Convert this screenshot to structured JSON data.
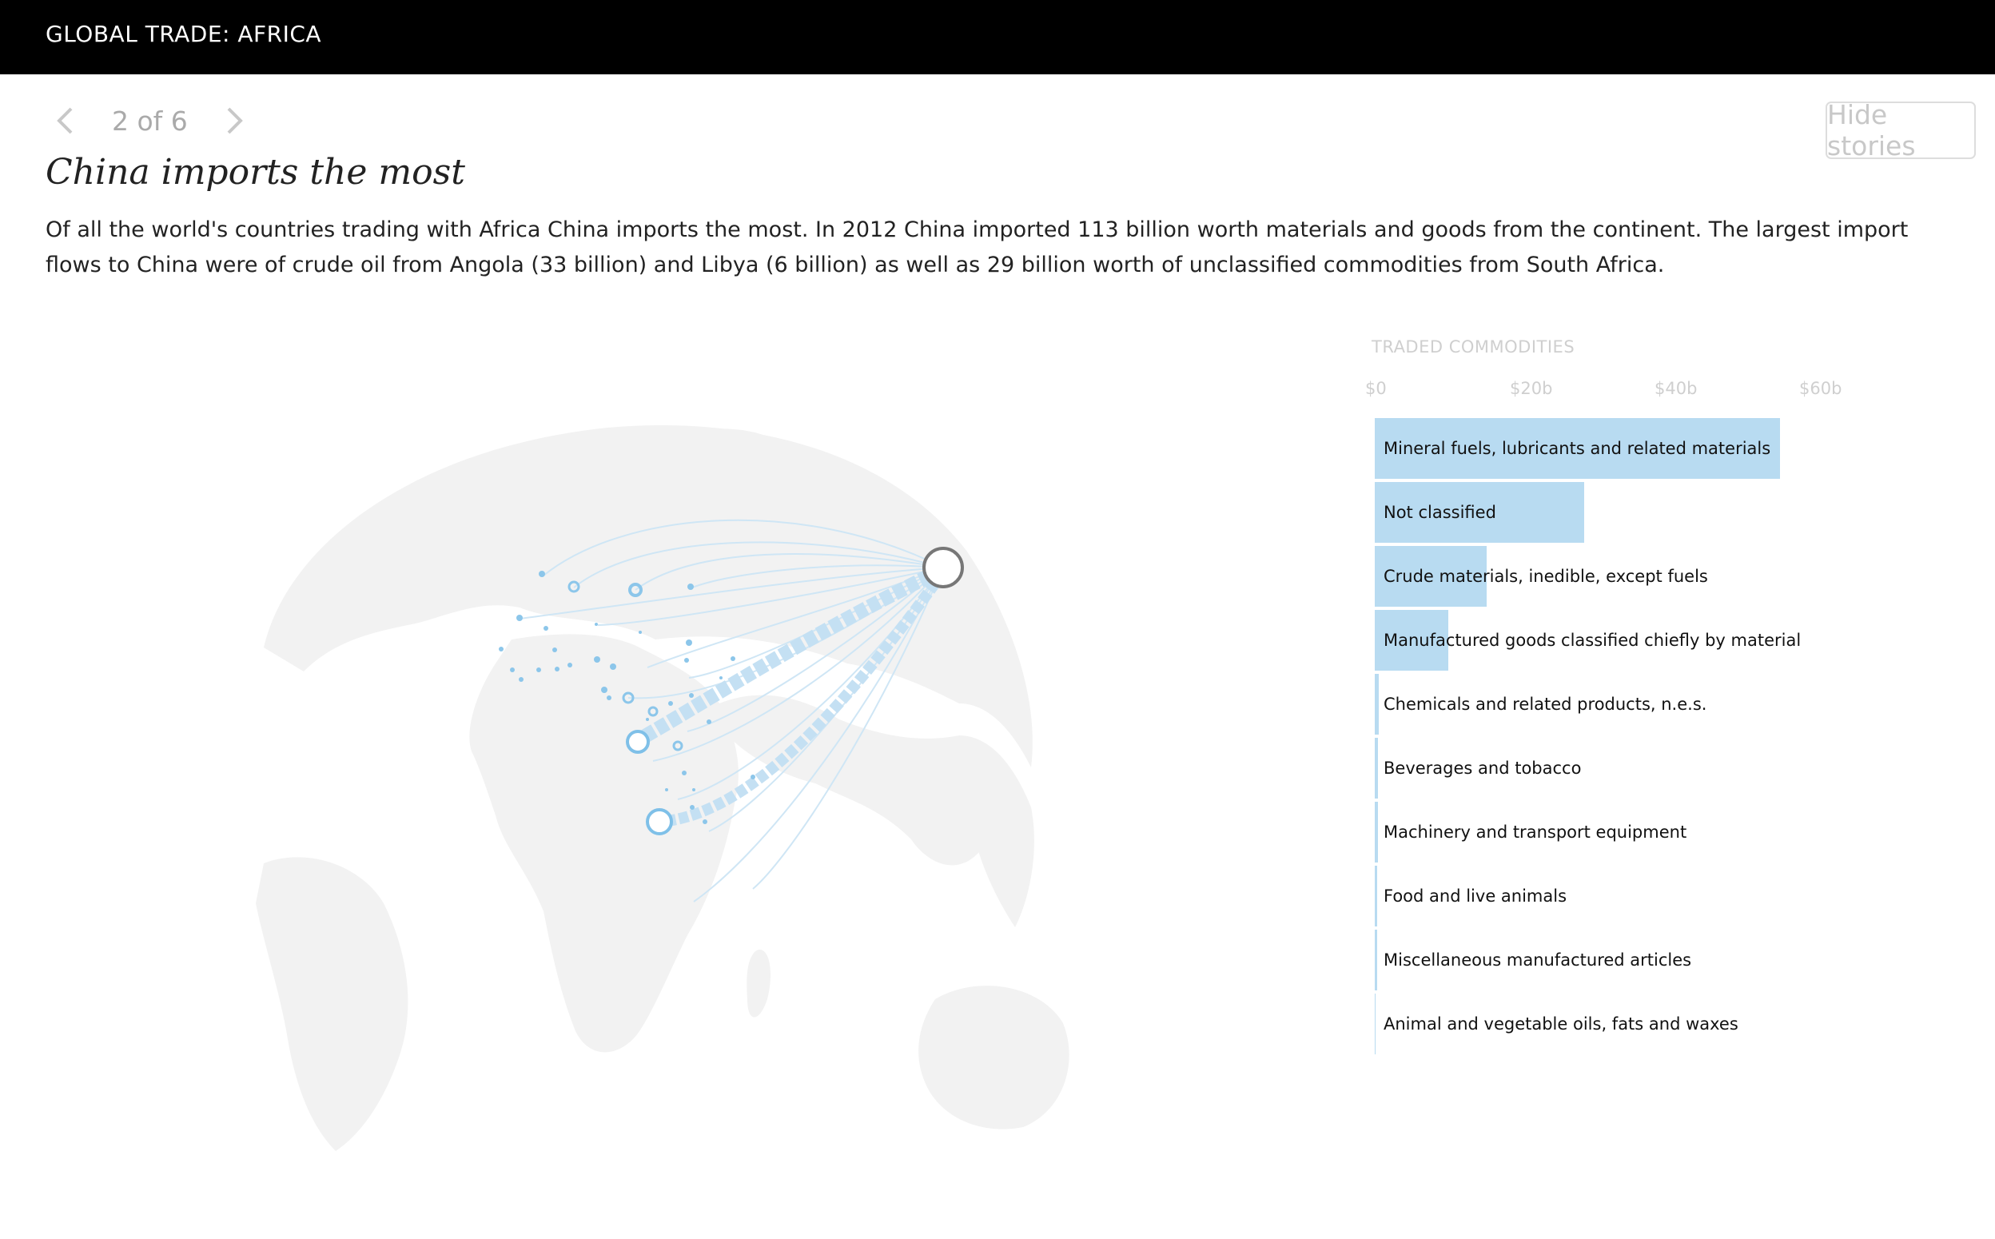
{
  "header": {
    "title": "GLOBAL TRADE: AFRICA"
  },
  "nav": {
    "pager": "2 of 6",
    "prev_icon": "chevron-left-icon",
    "next_icon": "chevron-right-icon"
  },
  "hide_button": {
    "label": "Hide stories"
  },
  "story": {
    "headline": "China imports the most",
    "body": "Of all the world's countries trading with Africa China imports the most. In 2012 China imported 113 billion worth materials and goods from the continent. The largest import flows to China were of crude oil from Angola (33 billion) and Libya (6 billion) as well as 29 billion worth of unclassified commodities from South Africa."
  },
  "colors": {
    "accent": "#b8dbf1",
    "flow": "#8cc6ea",
    "land": "#f2f2f2",
    "header_bg": "#000000"
  },
  "chart_data": {
    "type": "bar",
    "orientation": "horizontal",
    "title": "TRADED COMMODITIES",
    "x_ticks": [
      "$0",
      "$20b",
      "$40b",
      "$60b"
    ],
    "xlim": [
      0,
      60
    ],
    "unit": "billion USD",
    "categories": [
      "Mineral fuels, lubricants and related materials",
      "Not classified",
      "Crude materials, inedible, except fuels",
      "Manufactured goods classified chiefly by material",
      "Chemicals and related products, n.e.s.",
      "Beverages and tobacco",
      "Machinery and transport equipment",
      "Food and live animals",
      "Miscellaneous manufactured articles",
      "Animal and vegetable oils, fats and waxes"
    ],
    "values": [
      56,
      29,
      15.5,
      10.2,
      0.5,
      0.4,
      0.4,
      0.3,
      0.3,
      0.1
    ]
  }
}
